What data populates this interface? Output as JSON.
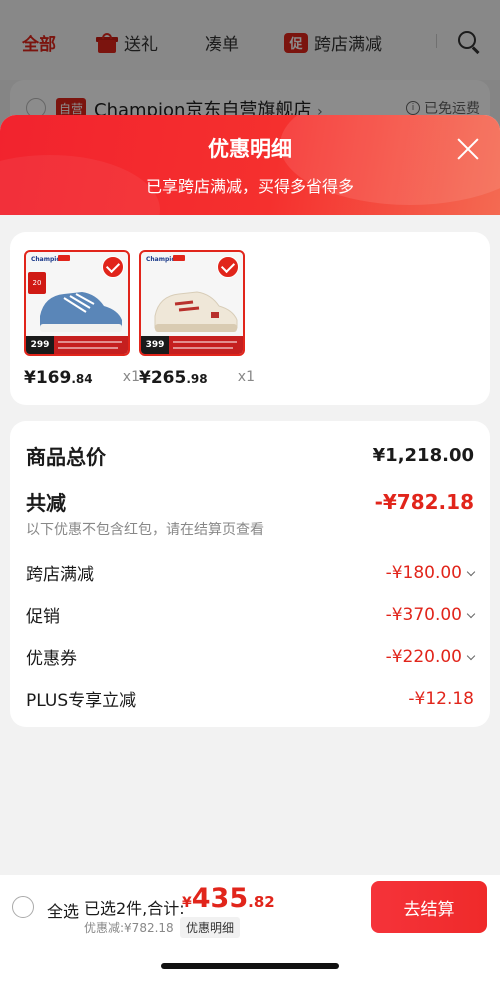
{
  "topnav": {
    "tabs": [
      {
        "label": "全部"
      },
      {
        "label": "送礼"
      },
      {
        "label": "凑单"
      },
      {
        "label": "跨店满减",
        "icon_text": "促"
      }
    ]
  },
  "store": {
    "tag": "自营",
    "name": "Champion京东自营旗舰店",
    "chevron": "›",
    "shipping": "已免运费"
  },
  "sheet": {
    "title": "优惠明细",
    "subtitle": "已享跨店满减，买得多省得多"
  },
  "products": [
    {
      "price_int": "¥169",
      "price_dec": ".84",
      "qty": "x1",
      "thumb_price": "299",
      "shoe_color": "#5a86b8",
      "shoe_accent": "#f1f1ef"
    },
    {
      "price_int": "¥265",
      "price_dec": ".98",
      "qty": "x1",
      "thumb_price": "399",
      "shoe_color": "#efe7d8",
      "shoe_accent": "#b8302c"
    }
  ],
  "summary": {
    "total_label": "商品总价",
    "total_value": "¥1,218.00",
    "reduce_label": "共减",
    "reduce_value": "-¥782.18",
    "note": "以下优惠不包含红包，请在结算页查看",
    "items": [
      {
        "label": "跨店满减",
        "value": "-¥180.00",
        "expandable": true
      },
      {
        "label": "促销",
        "value": "-¥370.00",
        "expandable": true
      },
      {
        "label": "优惠券",
        "value": "-¥220.00",
        "expandable": true
      },
      {
        "label": "PLUS专享立减",
        "value": "-¥12.18",
        "expandable": false
      }
    ]
  },
  "bottom": {
    "select_all": "全选",
    "selected_text": "已选2件,合计:",
    "total_currency": "¥",
    "total_int": "435",
    "total_dec": ".82",
    "saved": "优惠减:¥782.18",
    "detail_chip": "优惠明细",
    "checkout": "去结算"
  },
  "colors": {
    "accent": "#e1251b",
    "overlay": "rgba(0,0,0,0.45)"
  }
}
